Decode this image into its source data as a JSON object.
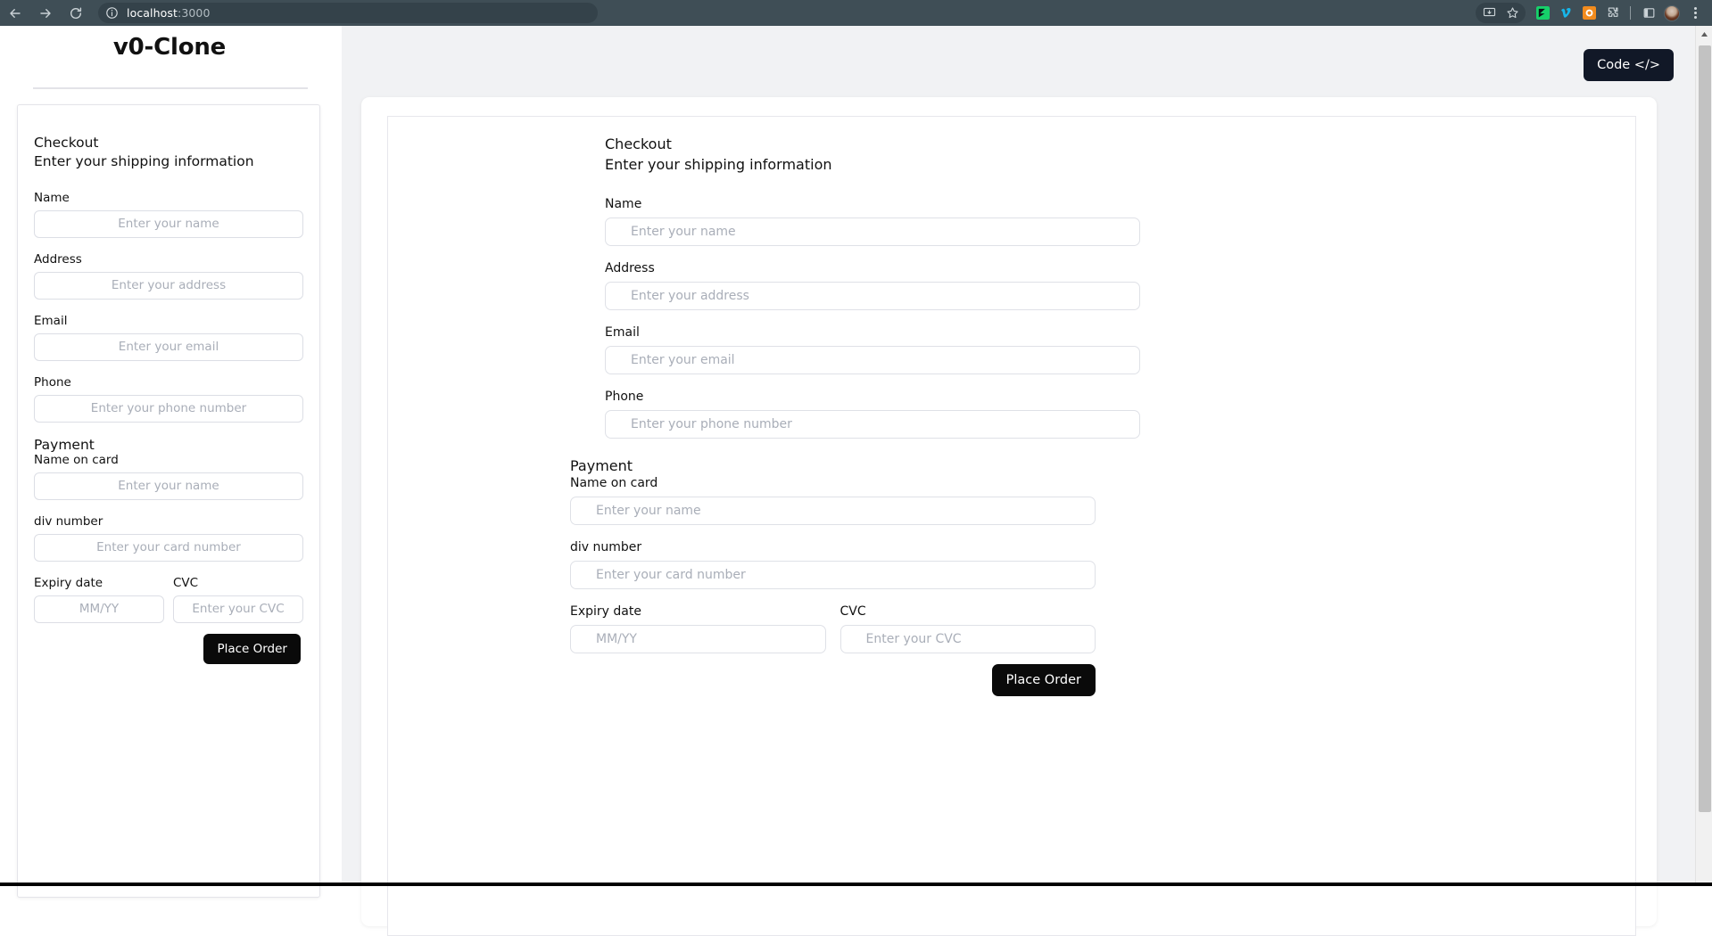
{
  "browser": {
    "back_label": "Back",
    "forward_label": "Forward",
    "reload_label": "Reload",
    "site_info_label": "View site information",
    "url_host": "localhost",
    "url_port": ":3000",
    "url_full": "localhost:3000",
    "icons": {
      "back": "arrow-left-icon",
      "forward": "arrow-right-icon",
      "reload": "reload-icon",
      "site_info": "info-circle-icon",
      "install": "install-app-icon",
      "bookmark": "star-icon",
      "extension_green": "green-extension-icon",
      "extension_vimeo": "vimeo-extension-icon",
      "extension_orange": "orange-extension-icon",
      "extensions": "puzzle-piece-icon",
      "side_panel": "side-panel-icon",
      "avatar": "profile-avatar",
      "menu": "three-dot-menu-icon"
    },
    "colors": {
      "chrome_bg": "#3f4e56",
      "omnibox_bg": "#34424a",
      "ext_green": "#16c96a",
      "ext_vimeo": "#1ab7ea",
      "ext_orange": "#f08c1e"
    }
  },
  "sidebar": {
    "app_title": "v0-Clone",
    "checkout": {
      "heading": "Checkout",
      "subheading": "Enter your shipping information",
      "fields": [
        {
          "label": "Name",
          "placeholder": "Enter your name",
          "value": ""
        },
        {
          "label": "Address",
          "placeholder": "Enter your address",
          "value": ""
        },
        {
          "label": "Email",
          "placeholder": "Enter your email",
          "value": ""
        },
        {
          "label": "Phone",
          "placeholder": "Enter your phone number",
          "value": ""
        }
      ],
      "payment_title": "Payment",
      "payment_fields": [
        {
          "label": "Name on card",
          "placeholder": "Enter your name",
          "value": ""
        },
        {
          "label": "div number",
          "placeholder": "Enter your card number",
          "value": ""
        }
      ],
      "expiry": {
        "label": "Expiry date",
        "placeholder": "MM/YY",
        "value": ""
      },
      "cvc": {
        "label": "CVC",
        "placeholder": "Enter your CVC",
        "value": ""
      },
      "submit_label": "Place Order"
    }
  },
  "workspace": {
    "code_button_label": "Code </>",
    "preview": {
      "heading": "Checkout",
      "subheading": "Enter your shipping information",
      "fields": [
        {
          "label": "Name",
          "placeholder": "Enter your name",
          "value": ""
        },
        {
          "label": "Address",
          "placeholder": "Enter your address",
          "value": ""
        },
        {
          "label": "Email",
          "placeholder": "Enter your email",
          "value": ""
        },
        {
          "label": "Phone",
          "placeholder": "Enter your phone number",
          "value": ""
        }
      ],
      "payment_title": "Payment",
      "payment_fields": [
        {
          "label": "Name on card",
          "placeholder": "Enter your name",
          "value": ""
        },
        {
          "label": "div number",
          "placeholder": "Enter your card number",
          "value": ""
        }
      ],
      "expiry": {
        "label": "Expiry date",
        "placeholder": "MM/YY",
        "value": ""
      },
      "cvc": {
        "label": "CVC",
        "placeholder": "Enter your CVC",
        "value": ""
      },
      "submit_label": "Place Order"
    }
  },
  "theme": {
    "accent_dark": "#0a0a0a",
    "code_button_bg": "#111827",
    "workspace_bg": "#f1f2f4",
    "border": "#e4e4e9",
    "placeholder": "#a9aeb8"
  },
  "scrollbar": {
    "up_arrow": "scroll-up-arrow-icon"
  }
}
